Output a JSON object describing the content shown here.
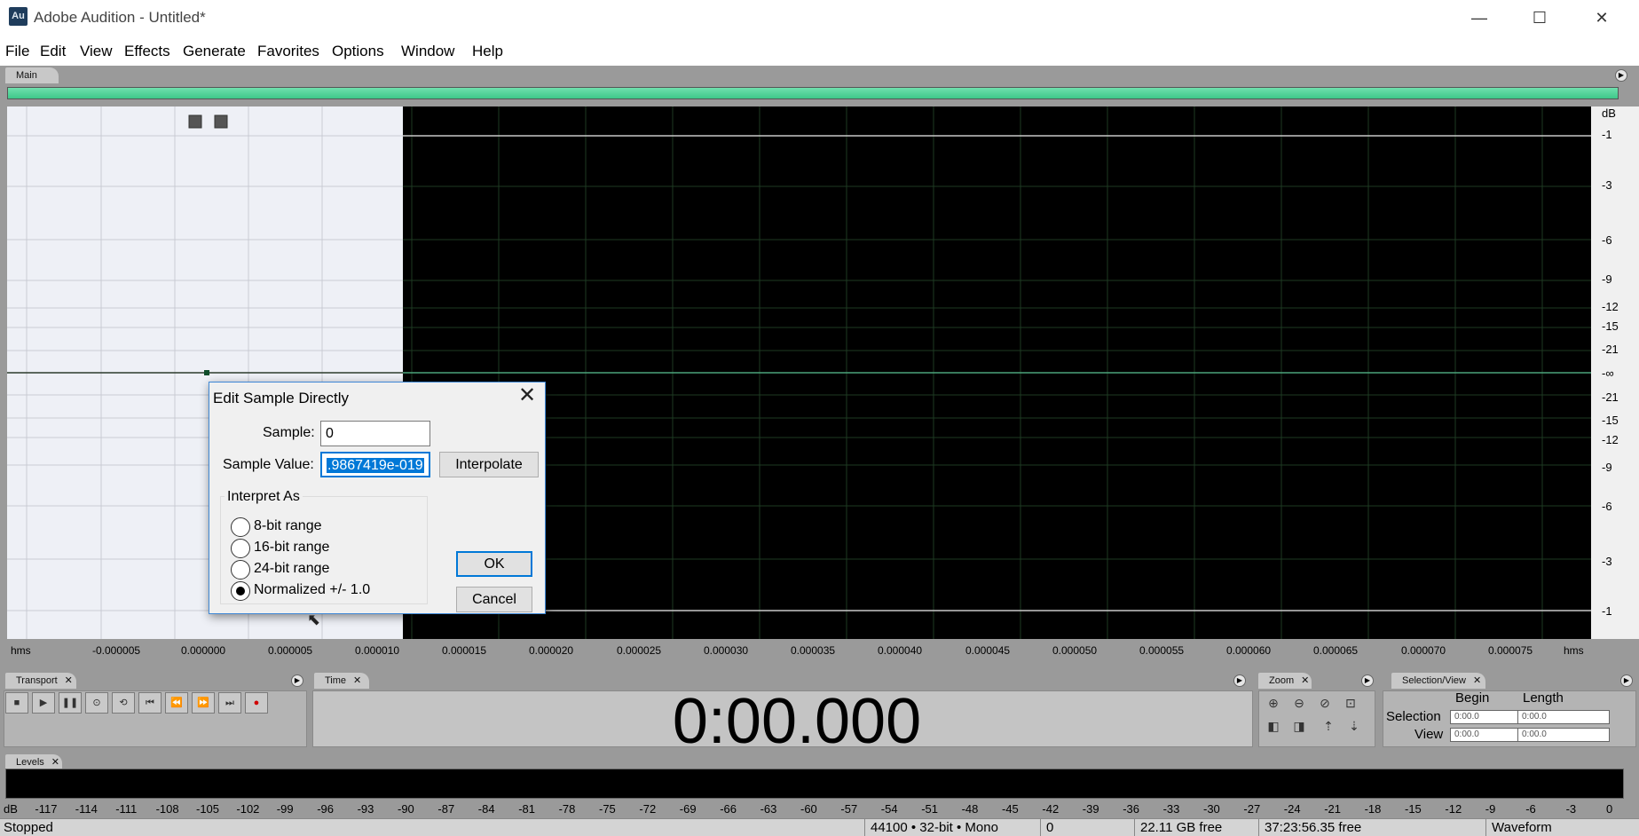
{
  "window": {
    "icon_text": "Au",
    "title": "Adobe Audition - Untitled*",
    "minimize": "—",
    "maximize": "☐",
    "close": "✕"
  },
  "menu": [
    "File",
    "Edit",
    "View",
    "Effects",
    "Generate",
    "Favorites",
    "Options",
    "Window",
    "Help"
  ],
  "main_panel": {
    "tab": "Main"
  },
  "waveform": {
    "db_unit": "dB",
    "db_labels": [
      "-1",
      "-3",
      "-6",
      "-9",
      "-12",
      "-15",
      "-21",
      "-∞",
      "-21",
      "-15",
      "-12",
      "-9",
      "-6",
      "-3",
      "-1"
    ],
    "time_labels": [
      "hms",
      "-0.000005",
      "0.000000",
      "0.000005",
      "0.000010",
      "0.000015",
      "0.000020",
      "0.000025",
      "0.000030",
      "0.000035",
      "0.000040",
      "0.000045",
      "0.000050",
      "0.000055",
      "0.000060",
      "0.000065",
      "0.000070",
      "0.000075",
      "hms"
    ],
    "colors": {
      "background": "#000000",
      "selected": "#eef0f6",
      "grid": "#1e3a22",
      "center_line": "#4aa37a"
    }
  },
  "transport": {
    "tab": "Transport",
    "buttons": [
      "stop",
      "play",
      "pause",
      "play-from-cursor",
      "loop",
      "go-to-start",
      "rewind",
      "fast-forward",
      "go-to-end",
      "record"
    ]
  },
  "time": {
    "tab": "Time",
    "display": "0:00.000"
  },
  "zoom": {
    "tab": "Zoom"
  },
  "selection_view": {
    "tab": "Selection/View",
    "begin_header": "Begin",
    "length_header": "Length",
    "selection_label": "Selection",
    "view_label": "View",
    "selection_begin": "0:00.0",
    "selection_length": "0:00.0",
    "view_begin": "0:00.0",
    "view_length": "0:00.0"
  },
  "levels": {
    "tab": "Levels",
    "scale": [
      "dB",
      "-117",
      "-114",
      "-111",
      "-108",
      "-105",
      "-102",
      "-99",
      "-96",
      "-93",
      "-90",
      "-87",
      "-84",
      "-81",
      "-78",
      "-75",
      "-72",
      "-69",
      "-66",
      "-63",
      "-60",
      "-57",
      "-54",
      "-51",
      "-48",
      "-45",
      "-42",
      "-39",
      "-36",
      "-33",
      "-30",
      "-27",
      "-24",
      "-21",
      "-18",
      "-15",
      "-12",
      "-9",
      "-6",
      "-3",
      "0"
    ]
  },
  "status": {
    "state": "Stopped",
    "format": "44100 • 32-bit • Mono",
    "counter": "0",
    "disk_free": "22.11 GB free",
    "time_free": "37:23:56.35 free",
    "view_mode": "Waveform"
  },
  "dialog": {
    "title": "Edit Sample Directly",
    "sample_label": "Sample:",
    "sample_value": "0",
    "value_label": "Sample Value:",
    "value_value": ".9867419e-019",
    "interpolate": "Interpolate",
    "group_label": "Interpret As",
    "options": [
      "8-bit range",
      "16-bit range",
      "24-bit range",
      "Normalized +/- 1.0"
    ],
    "selected_option": "Normalized +/- 1.0",
    "ok": "OK",
    "cancel": "Cancel"
  }
}
